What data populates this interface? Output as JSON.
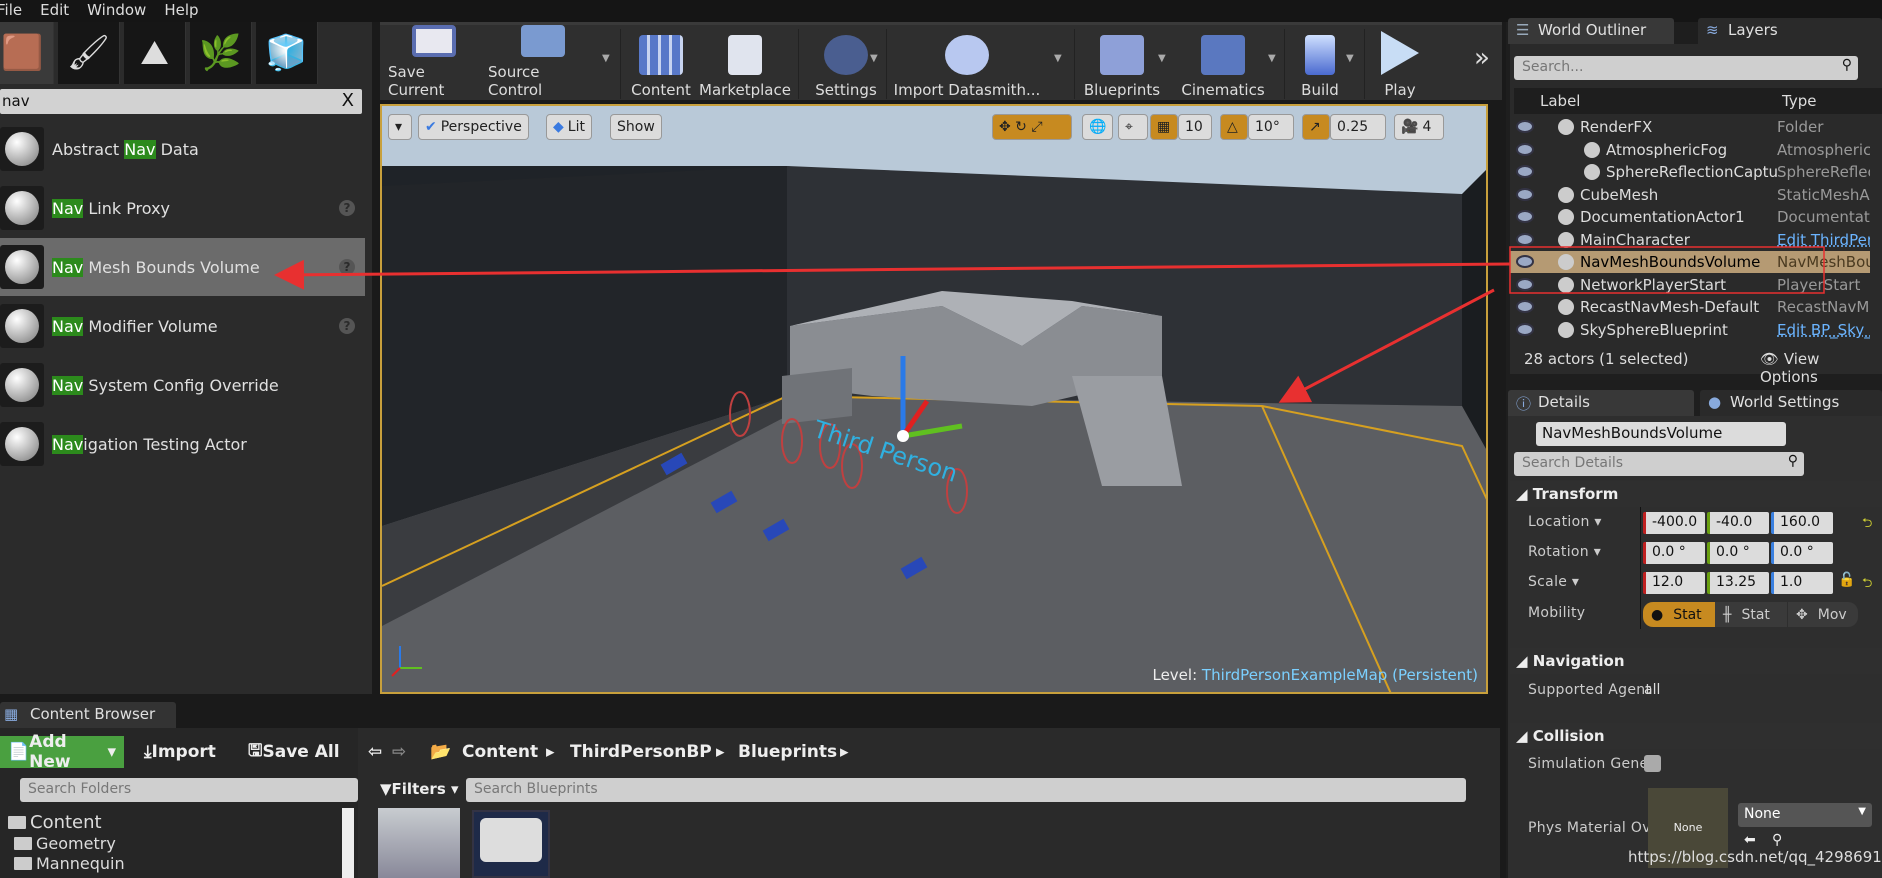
{
  "menu": [
    "File",
    "Edit",
    "Window",
    "Help"
  ],
  "modes": {
    "tabs": [
      "place-mode-icon",
      "paint-mode-icon",
      "landscape-mode-icon",
      "foliage-mode-icon",
      "geometry-mode-icon"
    ],
    "search": "nav",
    "items": [
      {
        "pre": "Abstract ",
        "hl": "Nav",
        "post": " Data",
        "selected": false,
        "help": false
      },
      {
        "pre": "",
        "hl": "Nav",
        "post": " Link Proxy",
        "selected": false,
        "help": true
      },
      {
        "pre": "",
        "hl": "Nav",
        "post": " Mesh Bounds Volume",
        "selected": true,
        "help": true
      },
      {
        "pre": "",
        "hl": "Nav",
        "post": " Modifier Volume",
        "selected": false,
        "help": true
      },
      {
        "pre": "",
        "hl": "Nav",
        "post": " System Config Override",
        "selected": false,
        "help": false
      },
      {
        "pre": "",
        "hl": "Nav",
        "post": "igation Testing Actor",
        "selected": false,
        "help": false
      }
    ]
  },
  "toolbar": {
    "buttons": [
      "Save Current",
      "Source Control",
      "Content",
      "Marketplace",
      "Settings",
      "Import Datasmith...",
      "Blueprints",
      "Cinematics",
      "Build",
      "Play"
    ],
    "more": "»"
  },
  "viewport": {
    "view_mode": "Perspective",
    "lighting": "Lit",
    "show": "Show",
    "grid_snap": "10",
    "rot_snap": "10°",
    "scale_snap": "0.25",
    "camera_speed": "4",
    "level_prefix": "Level:",
    "level_name": "ThirdPersonExampleMap (Persistent)",
    "overlay_text": "Third Person"
  },
  "outliner": {
    "tab": "World Outliner",
    "tab2": "Layers",
    "search_placeholder": "Search...",
    "col_label": "Label",
    "col_type": "Type",
    "rows": [
      {
        "label": "RenderFX",
        "type": "Folder",
        "indent": 1,
        "link": false,
        "selected": false
      },
      {
        "label": "AtmosphericFog",
        "type": "AtmosphericF",
        "indent": 2,
        "link": false,
        "selected": false
      },
      {
        "label": "SphereReflectionCaptu",
        "type": "SphereReflect",
        "indent": 2,
        "link": false,
        "selected": false
      },
      {
        "label": "CubeMesh",
        "type": "StaticMeshAc",
        "indent": 1,
        "link": false,
        "selected": false
      },
      {
        "label": "DocumentationActor1",
        "type": "Documentatio",
        "indent": 1,
        "link": false,
        "selected": false
      },
      {
        "label": "MainCharacter",
        "type": "Edit ThirdPer",
        "indent": 1,
        "link": true,
        "selected": false
      },
      {
        "label": "NavMeshBoundsVolume",
        "type": "NavMeshBour",
        "indent": 1,
        "link": false,
        "selected": true
      },
      {
        "label": "NetworkPlayerStart",
        "type": "PlayerStart",
        "indent": 1,
        "link": false,
        "selected": false
      },
      {
        "label": "RecastNavMesh-Default",
        "type": "RecastNavMe",
        "indent": 1,
        "link": false,
        "selected": false
      },
      {
        "label": "SkySphereBlueprint",
        "type": "Edit BP_Sky_",
        "indent": 1,
        "link": true,
        "selected": false
      }
    ],
    "footer": "28 actors (1 selected)",
    "view_options": "View Options"
  },
  "details": {
    "tab": "Details",
    "tab2": "World Settings",
    "actor_name": "NavMeshBoundsVolume",
    "search_placeholder": "Search Details",
    "transform": {
      "title": "Transform",
      "location_label": "Location",
      "location": [
        "-400.0",
        "-40.0",
        "160.0"
      ],
      "rotation_label": "Rotation",
      "rotation": [
        "0.0 °",
        "0.0 °",
        "0.0 °"
      ],
      "scale_label": "Scale",
      "scale": [
        "12.0",
        "13.25",
        "1.0"
      ],
      "mobility_label": "Mobility",
      "mobility": [
        "Stat",
        "Stat",
        "Mov"
      ],
      "mobility_selected": 0
    },
    "navigation": {
      "title": "Navigation",
      "agent_label": "Supported Agent",
      "agent_value": "all"
    },
    "collision": {
      "title": "Collision",
      "sim_label": "Simulation Gener",
      "sim_checked": false,
      "phys_label": "Phys Material Ov",
      "thumb": "None",
      "select": "None"
    }
  },
  "content_browser": {
    "tab": "Content Browser",
    "add_new": "Add New",
    "import": "Import",
    "save_all": "Save All",
    "path": [
      "Content",
      "ThirdPersonBP",
      "Blueprints"
    ],
    "search_folders": "Search Folders",
    "filters": "Filters",
    "search_assets": "Search Blueprints",
    "tree": [
      "Content",
      "Geometry",
      "Mannequin"
    ]
  },
  "watermark": "https://blog.csdn.net/qq_42986916",
  "colors": {
    "accent": "#c78a20",
    "selection": "#b59a73",
    "highlight": "#2c8a1c",
    "annotation": "#e83030"
  }
}
